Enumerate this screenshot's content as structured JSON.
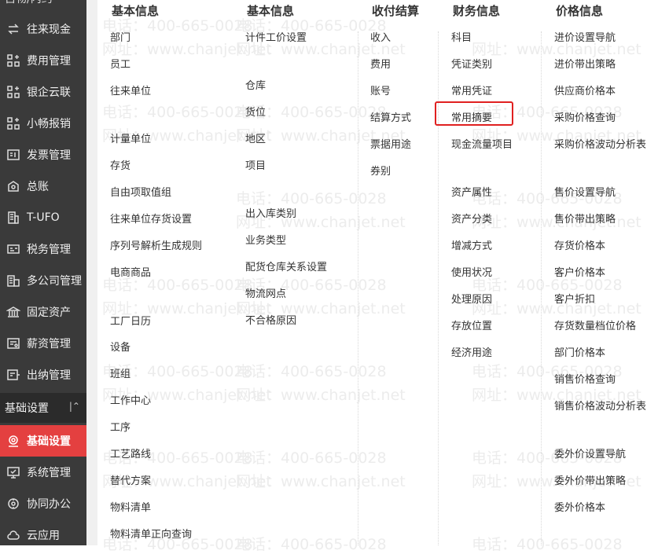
{
  "sidebar": {
    "top_stub": "自物/内约",
    "items": [
      {
        "label": "往来现金",
        "icon": "exchange-icon"
      },
      {
        "label": "费用管理",
        "icon": "grid-plus-icon"
      },
      {
        "label": "银企云联",
        "icon": "grid-plus-icon"
      },
      {
        "label": "小畅报销",
        "icon": "grid-plus-icon"
      },
      {
        "label": "发票管理",
        "icon": "invoice-icon"
      },
      {
        "label": "总账",
        "icon": "ledger-icon"
      },
      {
        "label": "T-UFO",
        "icon": "building-icon"
      },
      {
        "label": "税务管理",
        "icon": "tax-card-icon"
      },
      {
        "label": "多公司管理",
        "icon": "multi-company-icon"
      },
      {
        "label": "固定资产",
        "icon": "bank-icon"
      },
      {
        "label": "薪资管理",
        "icon": "payroll-icon"
      },
      {
        "label": "出纳管理",
        "icon": "cashier-icon"
      }
    ],
    "section_header": "基础设置",
    "section_items": [
      {
        "label": "基础设置",
        "icon": "settings-target-icon",
        "active": true
      },
      {
        "label": "系统管理",
        "icon": "monitor-icon"
      },
      {
        "label": "协同办公",
        "icon": "collab-icon"
      },
      {
        "label": "云应用",
        "icon": "cloud-icon"
      }
    ]
  },
  "columns": [
    {
      "header": "基本信息",
      "items": [
        "部门",
        "员工",
        "往来单位",
        "计量单位",
        "存货",
        "自由项取值组",
        "往来单位存货设置",
        "序列号解析生成规则",
        "电商商品",
        "工厂日历",
        "设备",
        "班组",
        "工作中心",
        "工序",
        "工艺路线",
        "替代方案",
        "物料清单",
        "物料清单正向查询"
      ]
    },
    {
      "header": "基本信息",
      "items": [
        "计件工价设置",
        "仓库",
        "货位",
        "地区",
        "项目",
        "出入库类别",
        "业务类型",
        "配货仓库关系设置",
        "物流网点",
        "不合格原因"
      ]
    },
    {
      "header": "收付结算",
      "items": [
        "收入",
        "费用",
        "账号",
        "结算方式",
        "票据用途",
        "券别"
      ]
    },
    {
      "header": "财务信息",
      "items": [
        "科目",
        "凭证类别",
        "常用凭证",
        "常用摘要",
        "现金流量项目",
        "资产属性",
        "资产分类",
        "增减方式",
        "使用状况",
        "处理原因",
        "存放位置",
        "经济用途"
      ]
    },
    {
      "header": "价格信息",
      "items": [
        "进价设置导航",
        "进价带出策略",
        "供应商价格本",
        "采购价格查询",
        "采购价格波动分析表",
        "售价设置导航",
        "售价带出策略",
        "存货价格本",
        "客户价格本",
        "客户折扣",
        "存货数量档位价格",
        "部门价格本",
        "销售价格查询",
        "销售价格波动分析表",
        "委外价设置导航",
        "委外价带出策略",
        "委外价格本"
      ]
    }
  ],
  "watermark": {
    "phone": "电话：400-665-0028",
    "site": "网址：www.chanjet.net"
  },
  "highlight_color": "#e02020",
  "active_color": "#e44040"
}
